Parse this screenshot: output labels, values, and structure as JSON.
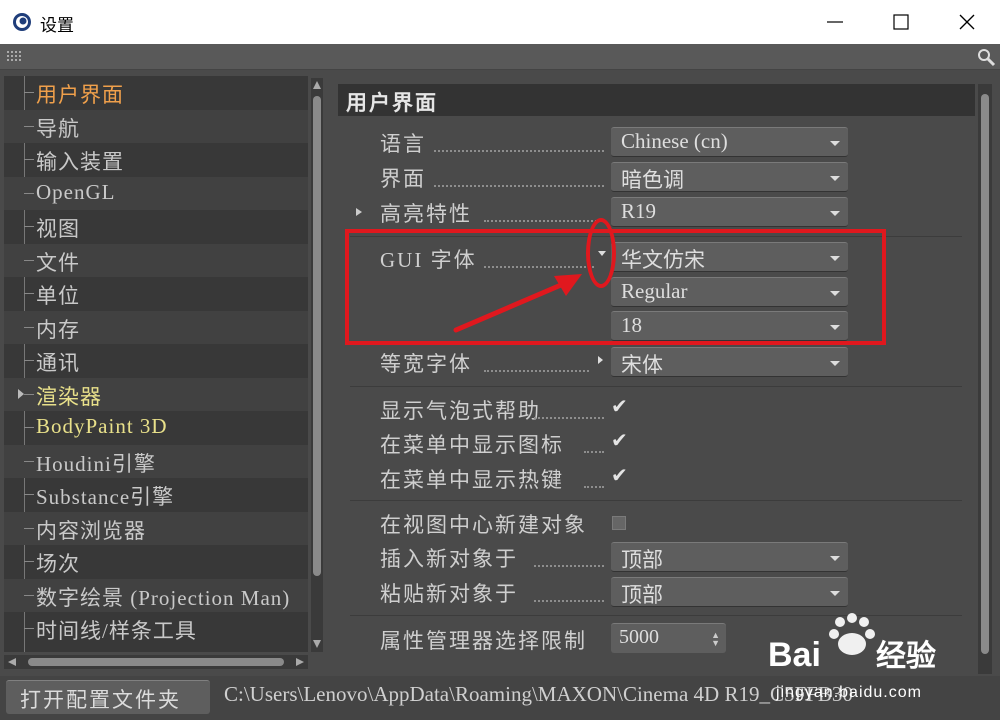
{
  "window": {
    "title": "设置",
    "controls": [
      "minimize",
      "maximize",
      "close"
    ]
  },
  "sidebar": {
    "items": [
      {
        "label": "用户界面",
        "state": "active"
      },
      {
        "label": "导航"
      },
      {
        "label": "输入装置"
      },
      {
        "label": "OpenGL"
      },
      {
        "label": "视图"
      },
      {
        "label": "文件"
      },
      {
        "label": "单位"
      },
      {
        "label": "内存"
      },
      {
        "label": "通讯"
      },
      {
        "label": "渲染器",
        "state": "highlight",
        "expandable": true
      },
      {
        "label": "BodyPaint 3D",
        "state": "highlight"
      },
      {
        "label": "Houdini引擎"
      },
      {
        "label": "Substance引擎"
      },
      {
        "label": "内容浏览器"
      },
      {
        "label": "场次"
      },
      {
        "label": "数字绘景 (Projection Man)"
      },
      {
        "label": "时间线/样条工具"
      }
    ]
  },
  "panel": {
    "title": "用户界面",
    "language": {
      "label": "语言",
      "value": "Chinese (cn)"
    },
    "interface": {
      "label": "界面",
      "value": "暗色调"
    },
    "highlight": {
      "label": "高亮特性",
      "value": "R19"
    },
    "gui_font": {
      "label": "GUI 字体",
      "family": "华文仿宋",
      "style": "Regular",
      "size": "18"
    },
    "mono_font": {
      "label": "等宽字体",
      "value": "宋体"
    },
    "bubble_help": {
      "label": "显示气泡式帮助",
      "checked": true
    },
    "menu_icons": {
      "label": "在菜单中显示图标",
      "checked": true
    },
    "menu_hotkeys": {
      "label": "在菜单中显示热键",
      "checked": true
    },
    "new_object_center": {
      "label": "在视图中心新建对象",
      "checked": false
    },
    "insert_new": {
      "label": "插入新对象于",
      "value": "顶部"
    },
    "paste_new": {
      "label": "粘贴新对象于",
      "value": "顶部"
    },
    "attr_limit": {
      "label": "属性管理器选择限制",
      "value": "5000"
    }
  },
  "footer": {
    "open_config_label": "打开配置文件夹",
    "path": "C:\\Users\\Lenovo\\AppData\\Roaming\\MAXON\\Cinema 4D R19_C5FFB30"
  },
  "watermark": {
    "brand": "Bai",
    "brand_suffix": "经验",
    "url": "jingyan.baidu.com"
  },
  "colors": {
    "accent_active": "#f0a04b",
    "highlight_item": "#e8e08a",
    "annotation_red": "#e0181e"
  }
}
